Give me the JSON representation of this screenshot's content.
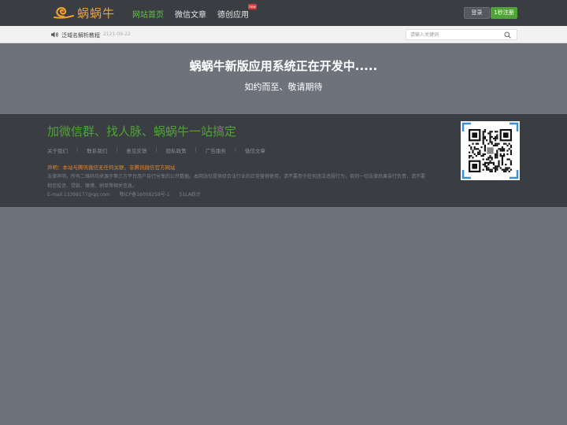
{
  "header": {
    "logo_text": "蜗蜗牛",
    "nav": [
      {
        "label": "网站首页",
        "active": true
      },
      {
        "label": "微信文章",
        "active": false
      },
      {
        "label": "德创应用",
        "active": false
      }
    ],
    "new_badge": "new",
    "login_label": "登录",
    "register_label": "1秒注册"
  },
  "notice": {
    "link_text": "泛域名解析教程",
    "date": "2121-09-22",
    "search_placeholder": "请输入关键词"
  },
  "hero": {
    "title": "蜗蜗牛新版应用系统正在开发中.....",
    "subtitle": "如约而至、敬请期待"
  },
  "footer": {
    "slogan": "加微信群、找人脉、蜗蜗牛一站搞定",
    "links": [
      "关于我们",
      "联系我们",
      "意见反馈",
      "隐私政策",
      "广告服务",
      "微信文章"
    ],
    "declaration": "声明：本站与腾讯微信无任何关联，非腾讯微信官方网站",
    "legal": "法律声明，所有二维码均来源于第三方平台用户自行分享的公开数据。本网站仅提供给合法行业的正常营销使用，请不要用于任何违法违规行为，否则一切法律后果自行负责，请不要相信投资、贷款、赌博、刷单等相关信息。",
    "email": "E-mail:13398177@qq.com",
    "icp": "鄂ICP备16008259号-1",
    "stats": "51LA统计"
  },
  "colors": {
    "accent_green": "#4fa337",
    "nav_active": "#62c14e",
    "logo_orange": "#f3a12b",
    "declaration_orange": "#e2842d"
  }
}
